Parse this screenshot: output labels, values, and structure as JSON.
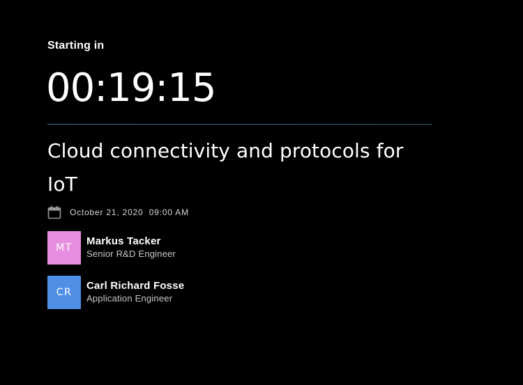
{
  "countdown": {
    "label": "Starting in",
    "time": "00:19:15"
  },
  "session": {
    "title": "Cloud connectivity and protocols for IoT",
    "date_icon": "calendar-icon",
    "date_time": "October 21, 2020  09:00 AM"
  },
  "speakers": [
    {
      "initials": "MT",
      "name": "Markus Tacker",
      "role": "Senior R&D Engineer",
      "avatar_color": "#e88ee0"
    },
    {
      "initials": "CR",
      "name": "Carl Richard Fosse",
      "role": "Application Engineer",
      "avatar_color": "#4f8fe6"
    }
  ],
  "colors": {
    "background": "#000000",
    "text_primary": "#ffffff",
    "divider": "#4f6f86"
  }
}
